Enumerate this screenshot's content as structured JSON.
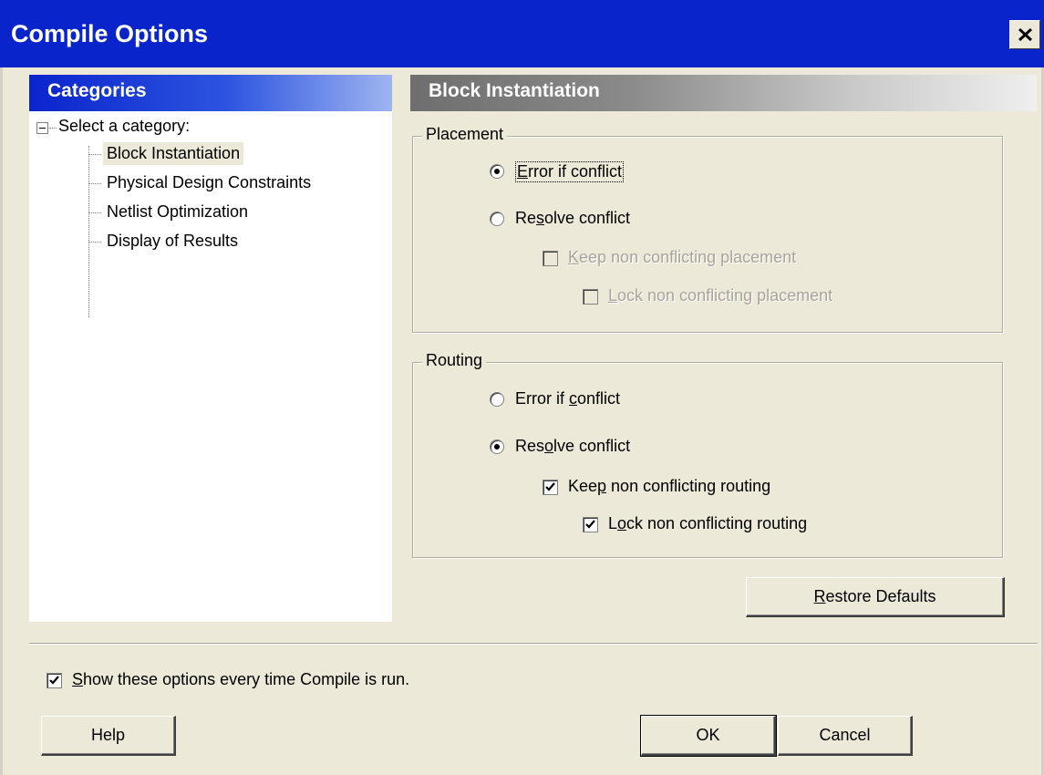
{
  "window": {
    "title": "Compile Options",
    "close_icon": "close-icon"
  },
  "categories": {
    "header": "Categories",
    "root_label": "Select a category:",
    "items": [
      {
        "label": "Block Instantiation",
        "selected": true
      },
      {
        "label": "Physical Design Constraints",
        "selected": false
      },
      {
        "label": "Netlist Optimization",
        "selected": false
      },
      {
        "label": "Display of Results",
        "selected": false
      }
    ]
  },
  "panel": {
    "header": "Block Instantiation"
  },
  "placement": {
    "title": "Placement",
    "error_if_conflict": {
      "pre": "",
      "u": "E",
      "post": "rror if conflict",
      "checked": true
    },
    "resolve_conflict": {
      "pre": "Re",
      "u": "s",
      "post": "olve conflict",
      "checked": false
    },
    "keep_noncon": {
      "pre": "",
      "u": "K",
      "post": "eep non conflicting placement",
      "checked": false,
      "enabled": false
    },
    "lock_noncon": {
      "pre": "",
      "u": "L",
      "post": "ock non conflicting placement",
      "checked": false,
      "enabled": false
    }
  },
  "routing": {
    "title": "Routing",
    "error_if_conflict": {
      "pre": "Error if ",
      "u": "c",
      "post": "onflict",
      "checked": false
    },
    "resolve_conflict": {
      "pre": "Res",
      "u": "o",
      "post": "lve conflict",
      "checked": true
    },
    "keep_noncon": {
      "pre": "Kee",
      "u": "p",
      "post": " non conflicting routing",
      "checked": true,
      "enabled": true
    },
    "lock_noncon": {
      "pre": "L",
      "u": "o",
      "post": "ck non conflicting routing",
      "checked": true,
      "enabled": true
    }
  },
  "buttons": {
    "restore": {
      "pre": "",
      "u": "R",
      "post": "estore Defaults"
    },
    "help": "Help",
    "ok": "OK",
    "cancel": "Cancel"
  },
  "footer": {
    "show_options": {
      "pre": "",
      "u": "S",
      "post": "how these options every time Compile is run.",
      "checked": true
    }
  }
}
